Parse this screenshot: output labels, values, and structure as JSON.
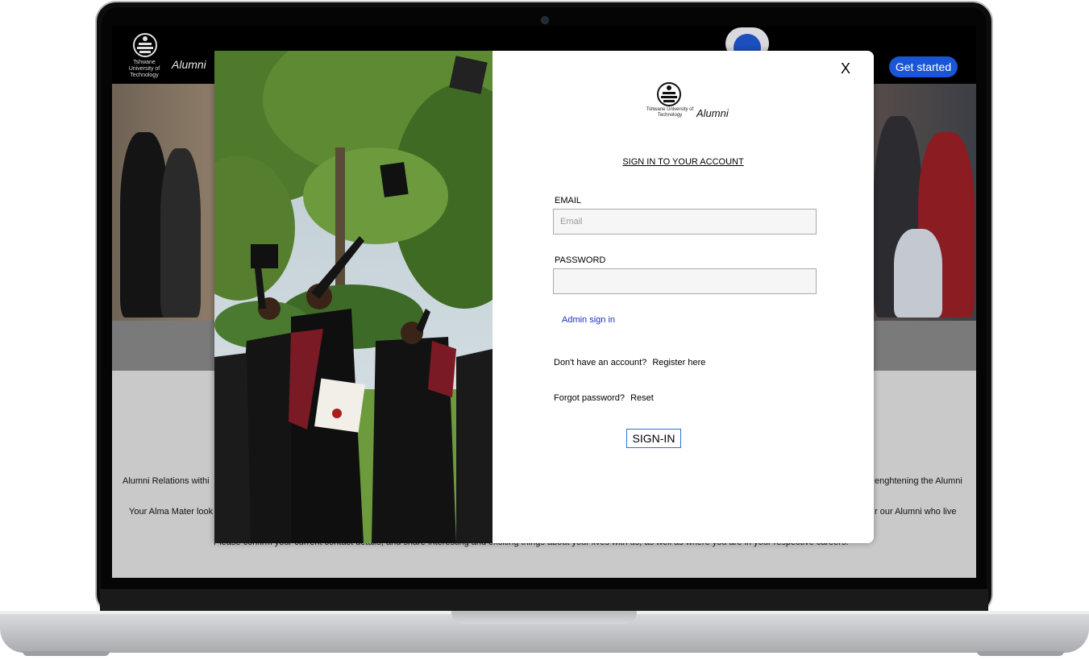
{
  "header": {
    "logo_small_text": "Tshwane University of Technology",
    "logo_alumni": "Alumni",
    "get_started_label": "Get started"
  },
  "page": {
    "paragraphs": [
      "Alumni Relations withi",
      "enghtening the Alumni",
      "Your Alma Mater look",
      "r our Alumni who live",
      "Please confirm your current contact details, and share interesting and exciting things about your lives with us, as well as where you are in your respective careers."
    ]
  },
  "modal": {
    "close_label": "X",
    "logo_small_text": "Tshwane University of Technology",
    "logo_alumni": "Alumni",
    "title": "SIGN IN TO YOUR ACCOUNT",
    "email_label": "EMAIL",
    "email_placeholder": "Email",
    "password_label": "PASSWORD",
    "admin_link": "Admin sign in",
    "no_account_text": "Don't have an account?",
    "register_link": "Register here",
    "forgot_text": "Forgot password?",
    "reset_link": "Reset",
    "signin_label": "SIGN-IN"
  },
  "colors": {
    "accent": "#1a55d6",
    "signin_border": "#2f6fd1",
    "admin_link": "#1a2fcc"
  }
}
